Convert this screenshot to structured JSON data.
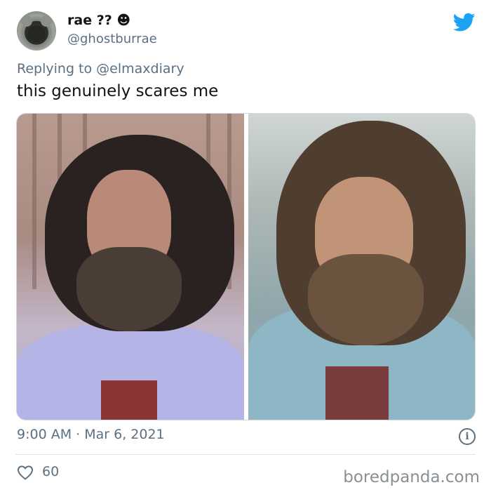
{
  "author": {
    "display_name": "rae ?? ☻",
    "username": "@ghostburrae"
  },
  "reply": {
    "prefix": "Replying to ",
    "mention": "@elmaxdiary"
  },
  "tweet": {
    "text": "this genuinely scares me",
    "timestamp": "9:00 AM · Mar 6, 2021",
    "like_count": "60"
  },
  "icons": {
    "brand": "twitter-bird-icon",
    "like": "heart-icon",
    "info": "info-icon"
  },
  "colors": {
    "twitter_blue": "#1DA1F2",
    "secondary_text": "#5b7083"
  },
  "watermark": "boredpanda.com"
}
